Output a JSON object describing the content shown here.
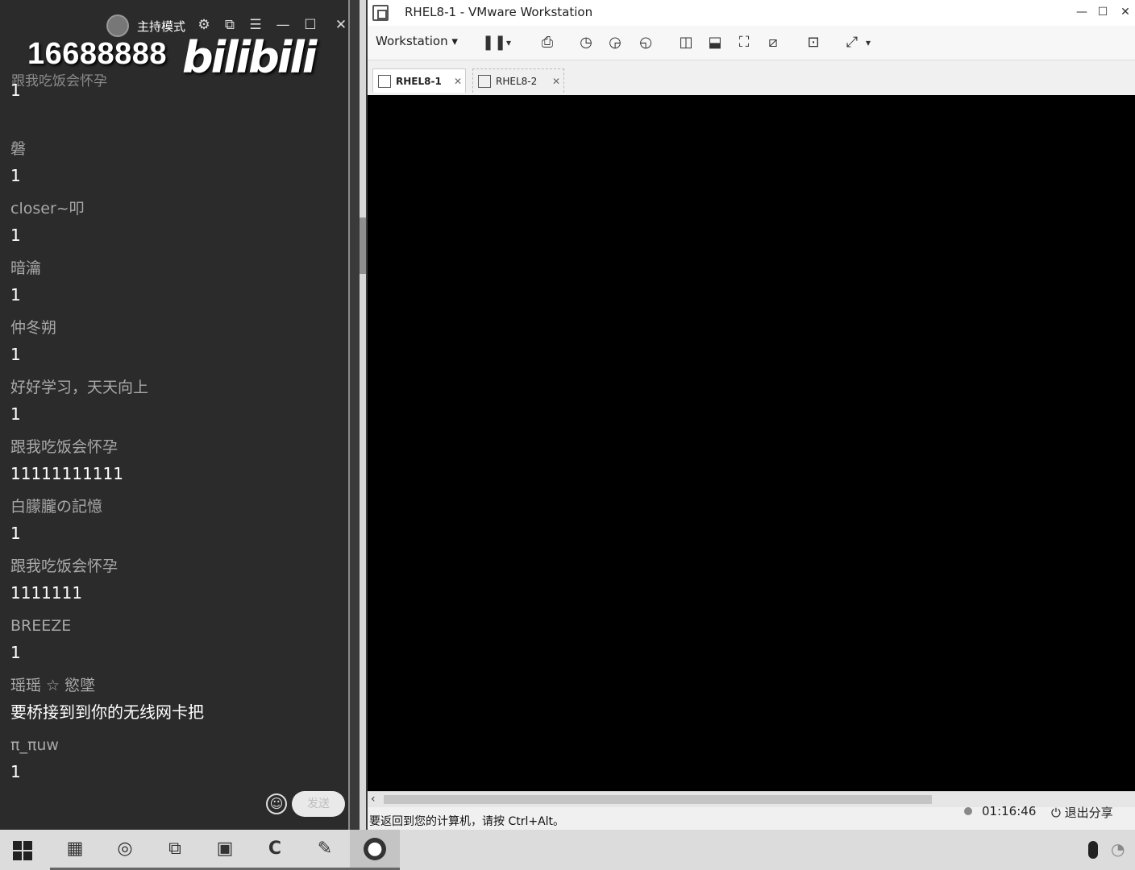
{
  "chat": {
    "host_mode": "主持模式",
    "live_number": "16688888",
    "logo_text": "bilibili",
    "faded_header": "跟我吃饭会怀孕",
    "messages": [
      {
        "user": "",
        "content": "1"
      },
      {
        "user": "磐",
        "content": "1"
      },
      {
        "user": "closer~叩",
        "content": "1"
      },
      {
        "user": "暗瀹",
        "content": "1"
      },
      {
        "user": "仲冬朔",
        "content": "1"
      },
      {
        "user": "好好学习，天天向上",
        "content": "1"
      },
      {
        "user": "跟我吃饭会怀孕",
        "content": "11111111111"
      },
      {
        "user": "白朦朧の記憶",
        "content": "1"
      },
      {
        "user": "跟我吃饭会怀孕",
        "content": "1111111"
      },
      {
        "user": "BREEZE",
        "content": "1"
      },
      {
        "user": "瑶瑶 ☆ 慾墜",
        "content": "要桥接到到你的无线网卡把"
      },
      {
        "user": "π_πuw",
        "content": "1"
      }
    ],
    "send_label": "发送",
    "icons": [
      "settings-icon",
      "external-link-icon",
      "menu-icon",
      "minimize-icon",
      "maximize-icon",
      "close-icon",
      "emoji-icon"
    ]
  },
  "vmware": {
    "window_title": "RHEL8-1 - VMware Workstation",
    "menu_label": "Workstation",
    "tabs": [
      {
        "label": "RHEL8-1",
        "active": true
      },
      {
        "label": "RHEL8-2",
        "active": false
      }
    ],
    "status_text": "要返回到您的计算机，请按 Ctrl+Alt。",
    "screen_color": "#000000"
  },
  "share": {
    "time": "01:16:46",
    "exit_label": "退出分享"
  },
  "taskbar": {
    "icons": [
      "windows-start-icon",
      "file-manager-icon",
      "browser-icon",
      "vmware-icon",
      "media-icon",
      "app-c-icon",
      "tool-icon",
      "obs-icon",
      "microphone-icon",
      "network-icon"
    ]
  }
}
